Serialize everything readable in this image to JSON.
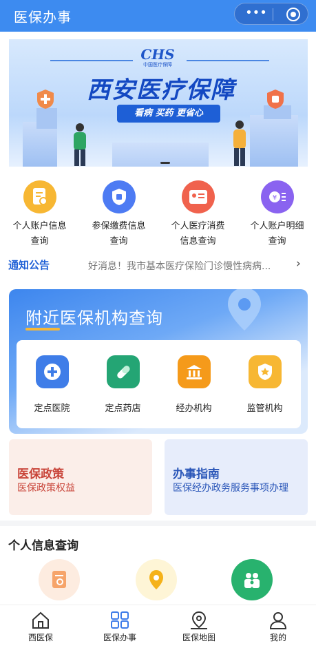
{
  "header": {
    "title": "医保办事",
    "more_icon": "more-dots-icon",
    "close_icon": "target-close-icon"
  },
  "banner": {
    "logo": "CHS",
    "logo_sub": "中国医疗保障",
    "title": "西安医疗保障",
    "slogan": "看病 买药 更省心"
  },
  "quick_services": [
    {
      "label_line1": "个人账户信息",
      "label_line2": "查询",
      "color": "#f7b733",
      "icon": "document-search-icon"
    },
    {
      "label_line1": "参保缴费信息",
      "label_line2": "查询",
      "color": "#4d7bf3",
      "icon": "shield-icon"
    },
    {
      "label_line1": "个人医疗消费",
      "label_line2": "信息查询",
      "color": "#f0624d",
      "icon": "yen-card-icon"
    },
    {
      "label_line1": "个人账户明细",
      "label_line2": "查询",
      "color": "#8a63f0",
      "icon": "yen-list-icon"
    }
  ],
  "notice": {
    "tag": "通知公告",
    "text": "好消息！我市基本医疗保险门诊慢性病病...",
    "chevron": "›"
  },
  "nearby": {
    "title": "附近医保机构查询",
    "items": [
      {
        "label": "定点医院",
        "color": "#3f7de8",
        "icon": "hospital-plus-icon"
      },
      {
        "label": "定点药店",
        "color": "#24a574",
        "icon": "pill-icon"
      },
      {
        "label": "经办机构",
        "color": "#f59a1a",
        "icon": "bank-building-icon"
      },
      {
        "label": "监管机构",
        "color": "#f7b733",
        "icon": "star-shield-icon"
      }
    ]
  },
  "policy_cards": [
    {
      "title": "医保政策",
      "subtitle": "医保政策权益",
      "bg": "#fbeee9",
      "color": "#c9453a"
    },
    {
      "title": "办事指南",
      "subtitle": "医保经办政务服务事项办理",
      "bg": "#e7edfb",
      "color": "#2a56b8"
    }
  ],
  "personal_info": {
    "title": "个人信息查询",
    "icons": [
      {
        "name": "doc-search-icon",
        "bg": "#fdece0",
        "fg": "#f08a3a"
      },
      {
        "name": "location-pin-icon",
        "bg": "#fef5d6",
        "fg": "#f5b21a"
      },
      {
        "name": "family-icon",
        "bg": "#28b26e",
        "fg": "#ffffff"
      }
    ]
  },
  "tabbar": [
    {
      "label": "西医保",
      "icon": "home-icon"
    },
    {
      "label": "医保办事",
      "icon": "grid-icon",
      "active": true
    },
    {
      "label": "医保地图",
      "icon": "map-pin-icon"
    },
    {
      "label": "我的",
      "icon": "user-icon"
    }
  ]
}
